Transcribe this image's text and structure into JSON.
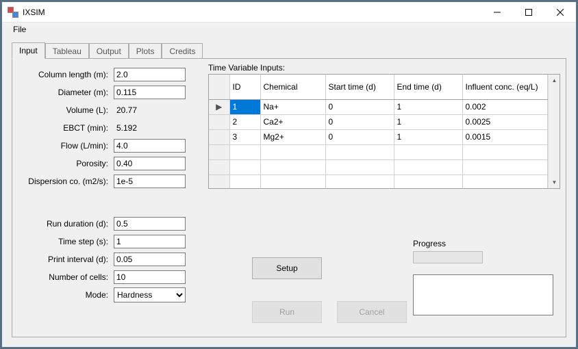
{
  "window": {
    "title": "IXSIM"
  },
  "menu": {
    "file": "File"
  },
  "tabs": {
    "input": "Input",
    "tableau": "Tableau",
    "output": "Output",
    "plots": "Plots",
    "credits": "Credits"
  },
  "form": {
    "column_length": {
      "label": "Column length (m):",
      "value": "2.0"
    },
    "diameter": {
      "label": "Diameter (m):",
      "value": "0.115"
    },
    "volume": {
      "label": "Volume (L):",
      "value": "20.77"
    },
    "ebct": {
      "label": "EBCT (min):",
      "value": "5.192"
    },
    "flow": {
      "label": "Flow (L/min):",
      "value": "4.0"
    },
    "porosity": {
      "label": "Porosity:",
      "value": "0.40"
    },
    "dispersion": {
      "label": "Dispersion co. (m2/s):",
      "value": "1e-5"
    },
    "run_duration": {
      "label": "Run duration (d):",
      "value": "0.5"
    },
    "time_step": {
      "label": "Time step (s):",
      "value": "1"
    },
    "print_interval": {
      "label": "Print interval (d):",
      "value": "0.05"
    },
    "num_cells": {
      "label": "Number of cells:",
      "value": "10"
    },
    "mode": {
      "label": "Mode:",
      "value": "Hardness"
    }
  },
  "tvi": {
    "label": "Time Variable Inputs:",
    "headers": {
      "id": "ID",
      "chemical": "Chemical",
      "start": "Start time (d)",
      "end": "End time (d)",
      "conc": "Influent conc. (eq/L)"
    },
    "rows": [
      {
        "id": "1",
        "chemical": "Na+",
        "start": "0",
        "end": "1",
        "conc": "0.002"
      },
      {
        "id": "2",
        "chemical": "Ca2+",
        "start": "0",
        "end": "1",
        "conc": "0.0025"
      },
      {
        "id": "3",
        "chemical": "Mg2+",
        "start": "0",
        "end": "1",
        "conc": "0.0015"
      }
    ]
  },
  "buttons": {
    "setup": "Setup",
    "run": "Run",
    "cancel": "Cancel"
  },
  "progress": {
    "label": "Progress"
  }
}
